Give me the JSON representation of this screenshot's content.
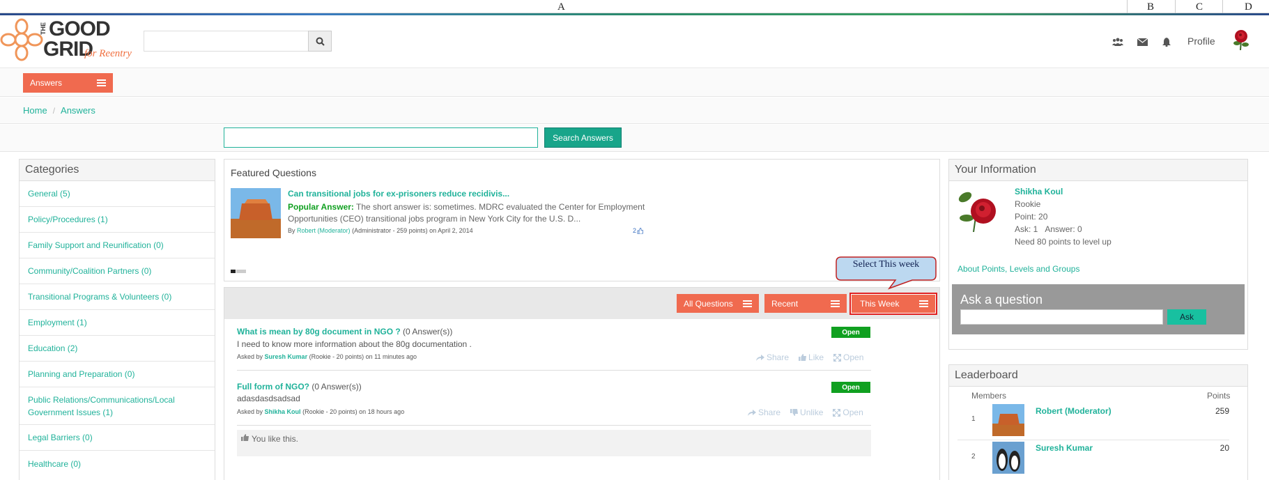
{
  "sheet_columns": [
    "A",
    "B",
    "C",
    "D"
  ],
  "logo": {
    "line1": "THE",
    "line2": "GOOD",
    "line3": "GRID",
    "tagline": "for Reentry"
  },
  "header": {
    "search_placeholder": "",
    "profile_label": "Profile"
  },
  "menu": {
    "answers_label": "Answers"
  },
  "breadcrumb": {
    "home": "Home",
    "sep": "/",
    "current": "Answers"
  },
  "answer_search": {
    "placeholder": "",
    "button": "Search Answers"
  },
  "categories": {
    "title": "Categories",
    "items": [
      "General (5)",
      "Policy/Procedures (1)",
      "Family Support and Reunification (0)",
      "Community/Coalition Partners (0)",
      "Transitional Programs & Volunteers (0)",
      "Employment (1)",
      "Education (2)",
      "Planning and Preparation (0)",
      "Public Relations/Communications/Local Government Issues (1)",
      "Legal Barriers (0)",
      "Healthcare (0)"
    ]
  },
  "featured": {
    "title": "Featured Questions",
    "question": "Can transitional jobs for ex-prisoners reduce recidivis...",
    "popular_label": "Popular Answer:",
    "answer_text": "The short answer is: sometimes. MDRC evaluated the Center for Employment Opportunities (CEO) transitional jobs program in New York City for the U.S. D...",
    "by_label": "By",
    "author": "Robert (Moderator)",
    "author_meta": "(Administrator - 259 points)",
    "date": "on April 2, 2014",
    "likes": "2"
  },
  "filters": {
    "all": "All Questions",
    "recent": "Recent",
    "week": "This Week",
    "callout": "Select This week"
  },
  "questions": [
    {
      "title": "What is mean by 80g document in NGO ?",
      "answers": "(0 Answer(s))",
      "body": "I need to know more information about the 80g documentation .",
      "asked_by": "Asked by",
      "user": "Suresh Kumar",
      "meta": "(Rookie - 20 points)",
      "time": "on 11 minutes ago",
      "status": "Open",
      "a1": "Share",
      "a2": "Like",
      "a3": "Open"
    },
    {
      "title": "Full form of NGO?",
      "answers": "(0 Answer(s))",
      "body": "adasdasdsadsad",
      "asked_by": "Asked by",
      "user": "Shikha Koul",
      "meta": "(Rookie - 20 points)",
      "time": "on 18 hours ago",
      "status": "Open",
      "a1": "Share",
      "a2": "Unlike",
      "a3": "Open"
    }
  ],
  "liked_text": "You like this.",
  "your_info": {
    "title": "Your Information",
    "name": "Shikha Koul",
    "rank": "Rookie",
    "point": "Point: 20",
    "ask": "Ask: 1",
    "answer": "Answer: 0",
    "need": "Need 80 points to level up",
    "about_link": "About Points, Levels and Groups"
  },
  "ask_box": {
    "title": "Ask a question",
    "button": "Ask"
  },
  "leaderboard": {
    "title": "Leaderboard",
    "col_members": "Members",
    "col_points": "Points",
    "rows": [
      {
        "rank": "1",
        "name": "Robert (Moderator)",
        "points": "259"
      },
      {
        "rank": "2",
        "name": "Suresh Kumar",
        "points": "20"
      }
    ]
  },
  "colors": {
    "accent": "#f06a4f",
    "teal": "#20b29a",
    "open": "#10a020",
    "highlight": "#e02020"
  }
}
